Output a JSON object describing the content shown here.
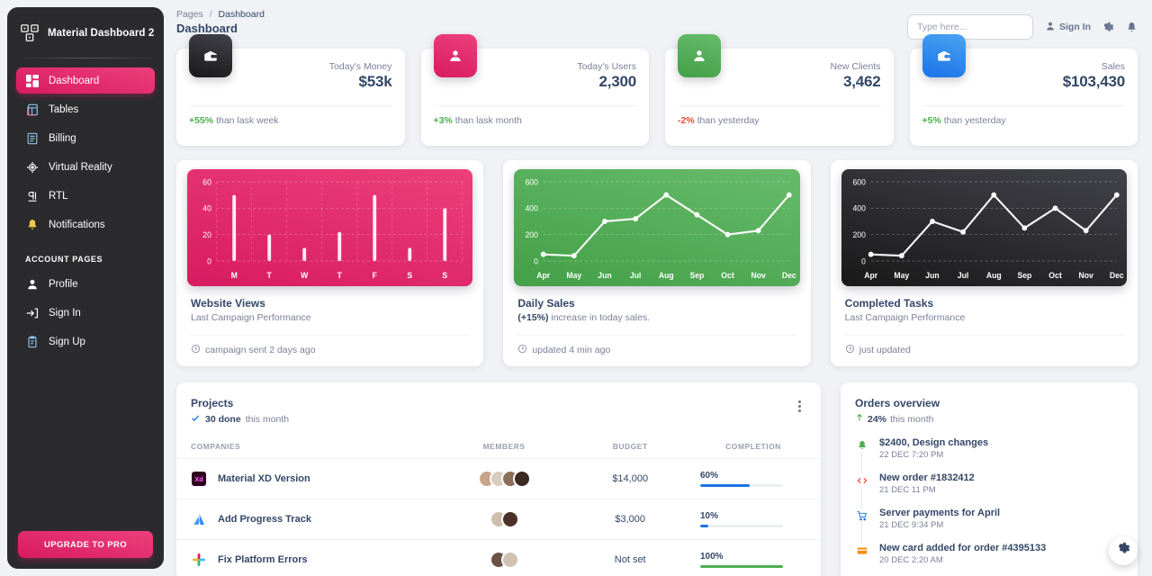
{
  "sidebar": {
    "brand": "Material Dashboard 2",
    "items": [
      {
        "label": "Dashboard",
        "icon": "dashboard-icon",
        "active": true
      },
      {
        "label": "Tables",
        "icon": "tables-icon",
        "active": false
      },
      {
        "label": "Billing",
        "icon": "billing-icon",
        "active": false
      },
      {
        "label": "Virtual Reality",
        "icon": "vr-icon",
        "active": false
      },
      {
        "label": "RTL",
        "icon": "rtl-icon",
        "active": false
      },
      {
        "label": "Notifications",
        "icon": "bell-icon",
        "active": false
      }
    ],
    "section_label": "ACCOUNT PAGES",
    "account_items": [
      {
        "label": "Profile",
        "icon": "person-icon"
      },
      {
        "label": "Sign In",
        "icon": "sign-in-icon"
      },
      {
        "label": "Sign Up",
        "icon": "sign-up-icon"
      }
    ],
    "upgrade_label": "UPGRADE TO PRO"
  },
  "header": {
    "breadcrumb_root": "Pages",
    "breadcrumb_sep": "/",
    "breadcrumb_current": "Dashboard",
    "page_title": "Dashboard",
    "search_placeholder": "Type here...",
    "search_value": "",
    "sign_in_label": "Sign In",
    "gear_icon": "gear-icon",
    "bell_icon": "bell-icon"
  },
  "stats": [
    {
      "label": "Today's Money",
      "value": "$53k",
      "delta": "+55%",
      "delta_dir": "up",
      "delta_text": "than lask week",
      "icon": "wallet-icon",
      "color": "dark"
    },
    {
      "label": "Today's Users",
      "value": "2,300",
      "delta": "+3%",
      "delta_dir": "up",
      "delta_text": "than lask month",
      "icon": "person-icon",
      "color": "pink"
    },
    {
      "label": "New Clients",
      "value": "3,462",
      "delta": "-2%",
      "delta_dir": "down",
      "delta_text": "than yesterday",
      "icon": "person-icon",
      "color": "green"
    },
    {
      "label": "Sales",
      "value": "$103,430",
      "delta": "+5%",
      "delta_dir": "up",
      "delta_text": "than yesterday",
      "icon": "store-icon",
      "color": "blue"
    }
  ],
  "chart_data": [
    {
      "type": "bar",
      "title": "Website Views",
      "subtitle": "Last Campaign Performance",
      "footer": "campaign sent 2 days ago",
      "theme": "pink",
      "categories": [
        "M",
        "T",
        "W",
        "T",
        "F",
        "S",
        "S"
      ],
      "values": [
        50,
        20,
        10,
        22,
        50,
        10,
        40
      ],
      "yticks": [
        0,
        20,
        40,
        60
      ],
      "ylim": [
        0,
        60
      ],
      "xlabel": "",
      "ylabel": "",
      "grid": true,
      "legend": "none"
    },
    {
      "type": "line",
      "title": "Daily Sales",
      "subtitle_prefix": "(+15%)",
      "subtitle_rest": " increase in today sales.",
      "footer": "updated 4 min ago",
      "theme": "green",
      "categories": [
        "Apr",
        "May",
        "Jun",
        "Jul",
        "Aug",
        "Sep",
        "Oct",
        "Nov",
        "Dec"
      ],
      "values": [
        50,
        40,
        300,
        320,
        500,
        350,
        200,
        230,
        500
      ],
      "yticks": [
        0,
        200,
        400,
        600
      ],
      "ylim": [
        0,
        600
      ],
      "xlabel": "",
      "ylabel": "",
      "grid": true,
      "legend": "none"
    },
    {
      "type": "line",
      "title": "Completed Tasks",
      "subtitle": "Last Campaign Performance",
      "footer": "just updated",
      "theme": "dark",
      "categories": [
        "Apr",
        "May",
        "Jun",
        "Jul",
        "Aug",
        "Sep",
        "Oct",
        "Nov",
        "Dec"
      ],
      "values": [
        50,
        40,
        300,
        220,
        500,
        250,
        400,
        230,
        500
      ],
      "yticks": [
        0,
        200,
        400,
        600
      ],
      "ylim": [
        0,
        600
      ],
      "xlabel": "",
      "ylabel": "",
      "grid": true,
      "legend": "none"
    }
  ],
  "projects": {
    "title": "Projects",
    "done_count": "30 done",
    "done_suffix": "this month",
    "columns": [
      "COMPANIES",
      "MEMBERS",
      "BUDGET",
      "COMPLETION"
    ],
    "rows": [
      {
        "name": "Material XD Version",
        "logo": "xd-logo",
        "members": [
          "#c8a48a",
          "#d9cdbf",
          "#8b6f5a",
          "#3b2a22"
        ],
        "budget": "$14,000",
        "completion": "60%",
        "completion_value": 60,
        "bar_color": "#1a73e8"
      },
      {
        "name": "Add Progress Track",
        "logo": "atlassian-logo",
        "members": [
          "#cdbfae",
          "#4a322a"
        ],
        "budget": "$3,000",
        "completion": "10%",
        "completion_value": 10,
        "bar_color": "#1a73e8"
      },
      {
        "name": "Fix Platform Errors",
        "logo": "slack-logo",
        "members": [
          "#6b5244",
          "#cfc2b3"
        ],
        "budget": "Not set",
        "completion": "100%",
        "completion_value": 100,
        "bar_color": "#4caf50"
      }
    ]
  },
  "orders": {
    "title": "Orders overview",
    "delta": "24%",
    "delta_suffix": "this month",
    "items": [
      {
        "title": "$2400, Design changes",
        "date": "22 DEC 7:20 PM",
        "icon": "bell-icon",
        "color": "#4caf50"
      },
      {
        "title": "New order #1832412",
        "date": "21 DEC 11 PM",
        "icon": "code-icon",
        "color": "#f44335"
      },
      {
        "title": "Server payments for April",
        "date": "21 DEC 9:34 PM",
        "icon": "cart-icon",
        "color": "#1a73e8"
      },
      {
        "title": "New card added for order #4395133",
        "date": "20 DEC 2:20 AM",
        "icon": "credit-card-icon",
        "color": "#fb8c00"
      }
    ]
  },
  "fab": {
    "icon": "gear-icon"
  },
  "colors": {
    "pink": "#d81b60",
    "green": "#43a047",
    "blue": "#1a73e8",
    "dark": "#191919",
    "text": "#344767",
    "muted": "#7b809a",
    "bg": "#f0f2f5"
  }
}
